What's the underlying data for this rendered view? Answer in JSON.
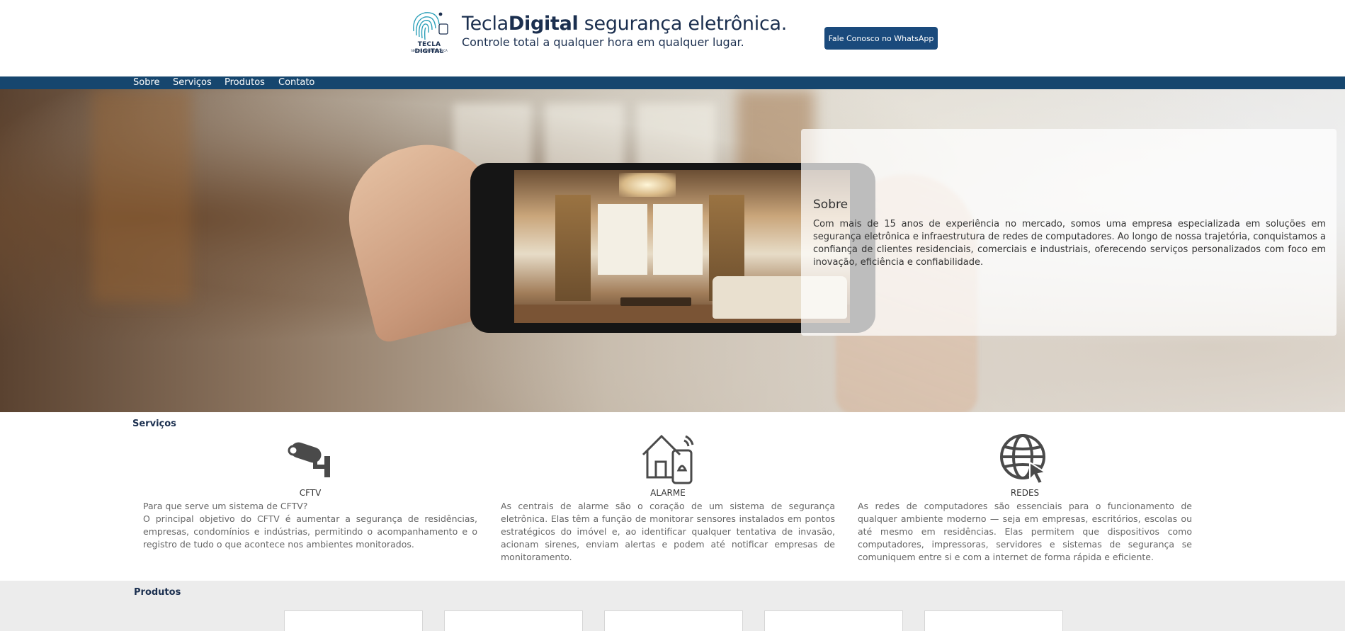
{
  "header": {
    "logo_word": "TECLA DIGITAL",
    "logo_sub": "SEGURANÇA ELETRÔNICA",
    "title_part1": "Tecla",
    "title_part2": "Digital",
    "title_part3": " segurança eletrônica.",
    "tagline": "Controle total a qualquer hora em qualquer lugar.",
    "whatsapp_label": "Fale Conosco no WhatsApp"
  },
  "nav": {
    "items": [
      "Sobre",
      "Serviços",
      "Produtos",
      "Contato"
    ]
  },
  "sobre": {
    "title": "Sobre",
    "text": "Com mais de 15 anos de experiência no mercado, somos uma empresa especializada em soluções em segurança eletrônica e infraestrutura de redes de computadores. Ao longo de nossa trajetória, conquistamos a confiança de clientes residenciais, comerciais e industriais, oferecendo serviços personalizados com foco em inovação, eficiência e confiabilidade."
  },
  "servicos": {
    "title": "Serviços",
    "items": [
      {
        "icon": "cctv-camera-icon",
        "name": "CFTV",
        "text": "Para que serve um sistema de CFTV?\nO principal objetivo do CFTV é aumentar a segurança de residências, empresas, condomínios e indústrias, permitindo o acompanhamento e o registro de tudo o que acontece nos ambientes monitorados."
      },
      {
        "icon": "home-alarm-icon",
        "name": "ALARME",
        "text": "As centrais de alarme são o coração de um sistema de segurança eletrônica. Elas têm a função de monitorar sensores instalados em pontos estratégicos do imóvel e, ao identificar qualquer tentativa de invasão, acionam sirenes, enviam alertas e podem até notificar empresas de monitoramento."
      },
      {
        "icon": "globe-network-icon",
        "name": "REDES",
        "text": "As redes de computadores são essenciais para o funcionamento de qualquer ambiente moderno — seja em empresas, escritórios, escolas ou até mesmo em residências. Elas permitem que dispositivos como computadores, impressoras, servidores e sistemas de segurança se comuniquem entre si e com a internet de forma rápida e eficiente."
      }
    ]
  },
  "produtos": {
    "title": "Produtos"
  },
  "colors": {
    "brand_navy": "#1b2f4f",
    "nav_blue": "#16466e",
    "button_blue": "#1a4a7c"
  }
}
